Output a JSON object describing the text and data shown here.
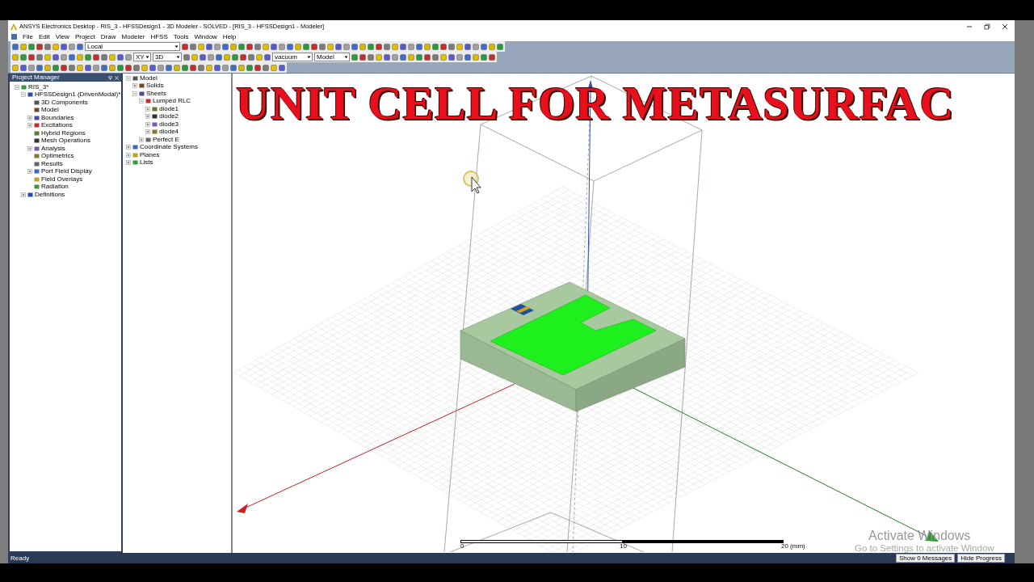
{
  "window": {
    "title": "ANSYS Electronics Desktop - RIS_3 - HFSSDesign1 - 3D Modeler - SOLVED - [RIS_3 - HFSSDesign1 - Modeler]"
  },
  "menu": [
    "File",
    "Edit",
    "View",
    "Project",
    "Draw",
    "Modeler",
    "HFSS",
    "Tools",
    "Window",
    "Help"
  ],
  "toolbar": {
    "coordinate_system": "Local",
    "plane": "XY",
    "dimension": "3D",
    "material": "vacuum",
    "view": "Model"
  },
  "project_manager": {
    "title": "Project Manager",
    "tree": [
      {
        "label": "RIS_3*",
        "expanded": true,
        "children": [
          {
            "label": "HFSSDesign1 (DrivenModal)*",
            "expanded": true,
            "children": [
              {
                "label": "3D Components"
              },
              {
                "label": "Model"
              },
              {
                "label": "Boundaries",
                "expanded": false
              },
              {
                "label": "Excitations",
                "expanded": false
              },
              {
                "label": "Hybrid Regions"
              },
              {
                "label": "Mesh Operations"
              },
              {
                "label": "Analysis",
                "expanded": false
              },
              {
                "label": "Optimetrics"
              },
              {
                "label": "Results"
              },
              {
                "label": "Port Field Display",
                "expanded": false
              },
              {
                "label": "Field Overlays"
              },
              {
                "label": "Radiation"
              }
            ]
          },
          {
            "label": "Definitions",
            "expanded": false
          }
        ]
      }
    ]
  },
  "model_tree": [
    {
      "label": "Model",
      "expanded": true,
      "children": [
        {
          "label": "Solids",
          "expanded": false
        },
        {
          "label": "Sheets",
          "expanded": true,
          "children": [
            {
              "label": "Lumped RLC",
              "expanded": true,
              "children": [
                {
                  "label": "diode1",
                  "expanded": false
                },
                {
                  "label": "diode2",
                  "expanded": false
                },
                {
                  "label": "diode3",
                  "expanded": false
                },
                {
                  "label": "diode4",
                  "expanded": false
                }
              ]
            },
            {
              "label": "Perfect E",
              "expanded": false
            }
          ]
        }
      ]
    },
    {
      "label": "Coordinate Systems",
      "expanded": false
    },
    {
      "label": "Planes",
      "expanded": false
    },
    {
      "label": "Lists",
      "expanded": false
    }
  ],
  "viewport": {
    "overlay_title": "UNIT CELL FOR METASURFAC",
    "scale": [
      "0",
      "10",
      "20 (mm)"
    ]
  },
  "activation_notice": [
    "Activate Windows",
    "Go to Settings to activate Window"
  ],
  "status_bar": {
    "text": "Ready",
    "buttons": [
      "Show 0 Messages",
      "Hide Progress"
    ]
  }
}
